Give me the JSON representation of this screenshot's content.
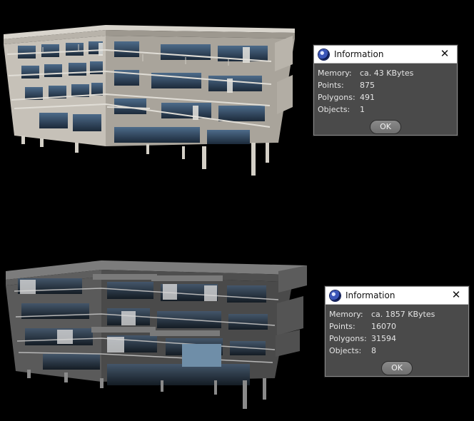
{
  "dialogs": [
    {
      "title": "Information",
      "rows": [
        {
          "label": "Memory:",
          "value": "ca. 43 KBytes"
        },
        {
          "label": "Points:",
          "value": "875"
        },
        {
          "label": "Polygons:",
          "value": "491"
        },
        {
          "label": "Objects:",
          "value": "1"
        }
      ],
      "ok_label": "OK",
      "close_glyph": "✕"
    },
    {
      "title": "Information",
      "rows": [
        {
          "label": "Memory:",
          "value": "ca. 1857 KBytes"
        },
        {
          "label": "Points:",
          "value": "16070"
        },
        {
          "label": "Polygons:",
          "value": "31594"
        },
        {
          "label": "Objects:",
          "value": "8"
        }
      ],
      "ok_label": "OK",
      "close_glyph": "✕"
    }
  ],
  "icons": {
    "app": "cinema4d-sphere-icon",
    "close": "close-icon"
  },
  "colors": {
    "background": "#000000",
    "dialog_body": "#4a4a4a",
    "titlebar": "#ffffff"
  }
}
